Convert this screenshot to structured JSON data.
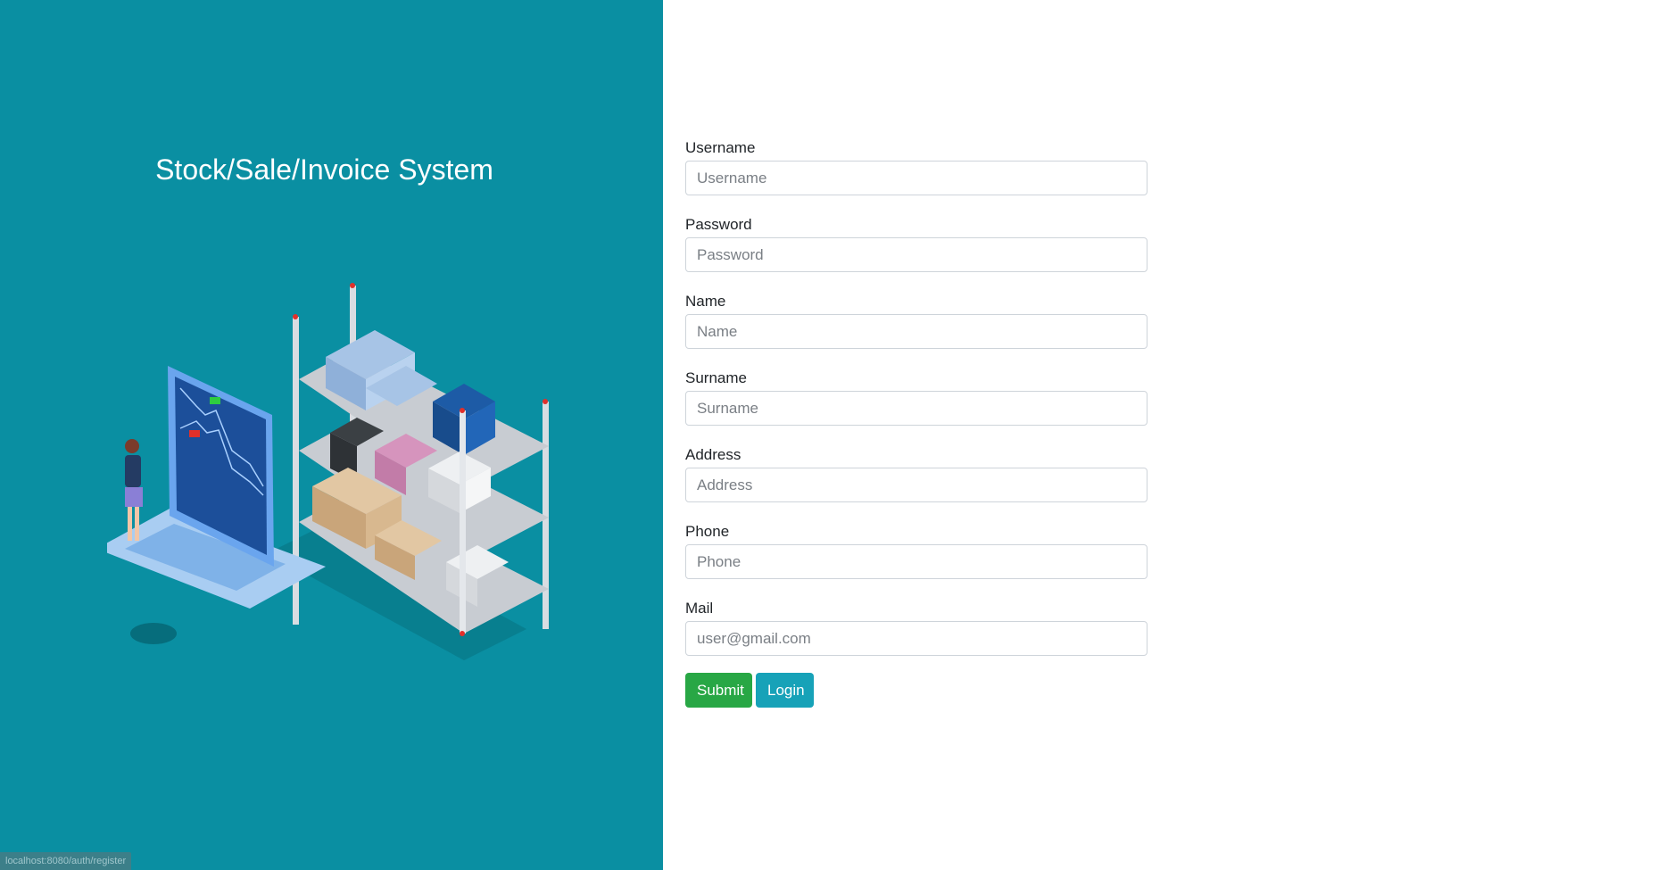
{
  "brand": {
    "title": "Stock/Sale/Invoice System",
    "panel_color": "#0a8fa2"
  },
  "illustration": {
    "name": "warehouse-laptop-illustration"
  },
  "form": {
    "fields": [
      {
        "key": "username",
        "label": "Username",
        "placeholder": "Username",
        "value": ""
      },
      {
        "key": "password",
        "label": "Password",
        "placeholder": "Password",
        "value": ""
      },
      {
        "key": "name",
        "label": "Name",
        "placeholder": "Name",
        "value": ""
      },
      {
        "key": "surname",
        "label": "Surname",
        "placeholder": "Surname",
        "value": ""
      },
      {
        "key": "address",
        "label": "Address",
        "placeholder": "Address",
        "value": ""
      },
      {
        "key": "phone",
        "label": "Phone",
        "placeholder": "Phone",
        "value": ""
      },
      {
        "key": "mail",
        "label": "Mail",
        "placeholder": "user@gmail.com",
        "value": ""
      }
    ],
    "submit_label": "Submit",
    "login_label": "Login",
    "submit_color": "#28a745",
    "login_color": "#17a2b8"
  },
  "status_bar": {
    "url": "localhost:8080/auth/register"
  }
}
